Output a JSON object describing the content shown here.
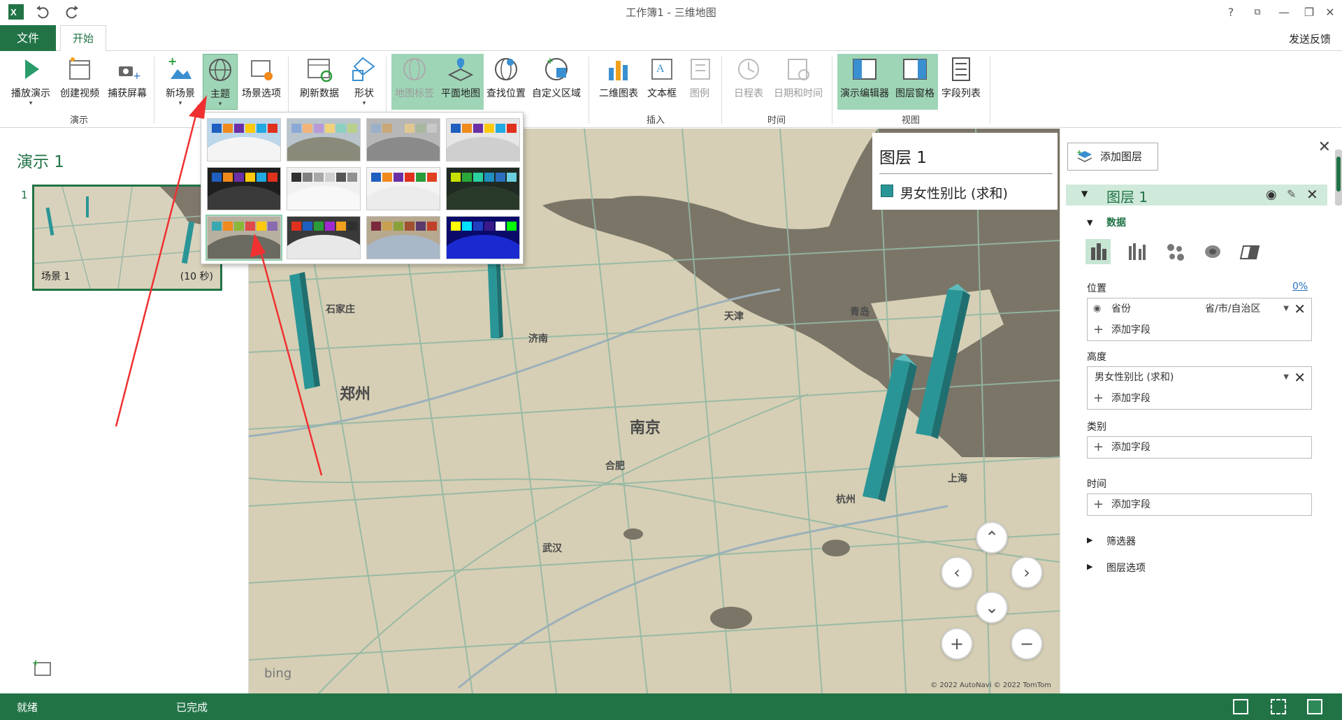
{
  "window": {
    "title": "工作簿1 - 三维地图",
    "help": "?",
    "minimize": "—",
    "restore": "❐",
    "close": "✕"
  },
  "tabs": {
    "file": "文件",
    "home": "开始",
    "feedback": "发送反馈"
  },
  "ribbon": {
    "play_tour": "播放演示",
    "create_video": "创建视频",
    "capture_screen": "捕获屏幕",
    "group_tour": "演示",
    "new_scene": "新场景",
    "theme": "主题",
    "scene_options": "场景选项",
    "refresh_data": "刷新数据",
    "shapes": "形状",
    "map_labels": "地图标签",
    "flat_map": "平面地图",
    "find_location": "查找位置",
    "custom_regions": "自定义区域",
    "chart_2d": "二维图表",
    "text_box": "文本框",
    "legend": "图例",
    "group_insert": "插入",
    "timeline": "日程表",
    "date_time": "日期和时间",
    "group_time": "时间",
    "tour_editor": "演示编辑器",
    "layer_pane": "图层窗格",
    "field_list": "字段列表",
    "group_view": "视图"
  },
  "tour": {
    "title": "演示 1",
    "scene_number": "1",
    "scene_label": "场景 1",
    "scene_duration": "(10 秒)"
  },
  "map": {
    "cities": [
      "石家庄",
      "济南",
      "郑州",
      "南京",
      "合肥",
      "上海",
      "青岛",
      "武汉",
      "杭州",
      "天津"
    ],
    "bing": "bing",
    "copyright": "© 2022 AutoNavi  © 2022 TomTom",
    "bar_color": "#2a9596"
  },
  "legend": {
    "title": "图层 1",
    "item": "男女性别比 (求和)"
  },
  "layer_pane": {
    "add_layer": "添加图层",
    "layer_name": "图层 1",
    "data_section": "数据",
    "location_label": "位置",
    "location_pct": "0%",
    "location_field": "省份",
    "location_type": "省/市/自治区",
    "add_field": "添加字段",
    "height_label": "高度",
    "height_field": "男女性别比 (求和)",
    "category_label": "类别",
    "time_label": "时间",
    "filters": "筛选器",
    "layer_options": "图层选项",
    "accent": "#217346"
  },
  "status": {
    "ready": "就绪",
    "done": "已完成"
  },
  "themes": [
    [
      "#1f5fbf",
      "#f08a1c",
      "#6b2fa6",
      "#ffc90e",
      "#21a9e1",
      "#e0301e"
    ],
    [
      "#8aa9d6",
      "#f2b37a",
      "#b79ad6",
      "#f0d27a",
      "#8ad0c0",
      "#b8d08a"
    ],
    [
      "#9ab0c8",
      "#c8a878",
      "#b8b8b8",
      "#e0c890",
      "#a8b8a0",
      "#c8c8c8"
    ],
    [
      "#1f5fbf",
      "#f08a1c",
      "#6b2fa6",
      "#ffc90e",
      "#21a9e1",
      "#e0301e"
    ],
    [
      "#1f5fbf",
      "#f08a1c",
      "#6b2fa6",
      "#ffc90e",
      "#21a9e1",
      "#e0301e"
    ],
    [
      "#303030",
      "#808080",
      "#a8a8a8",
      "#d0d0d0",
      "#555555",
      "#909090"
    ],
    [
      "#1f5fbf",
      "#f08a1c",
      "#6b2fa6",
      "#e0301e",
      "#2a9c3a",
      "#e04020"
    ],
    [
      "#c8e000",
      "#2aa83a",
      "#2ad0a0",
      "#1f8fbf",
      "#2a6fbf",
      "#6ad0e0"
    ],
    [
      "#3aa8b0",
      "#f08a1c",
      "#8ab83a",
      "#e04a4a",
      "#ffc90e",
      "#8a6ab0"
    ],
    [
      "#e0301e",
      "#1f5fbf",
      "#2a9c3a",
      "#a02ad0",
      "#f0a01c",
      "#303030"
    ],
    [
      "#7a2a3a",
      "#c8a050",
      "#8aa03a",
      "#a05030",
      "#5a3a6a",
      "#c0402a"
    ],
    [
      "#ffff00",
      "#00e0ff",
      "#1f3fbf",
      "#3a1a8a",
      "#ffffff",
      "#00ff00"
    ]
  ]
}
